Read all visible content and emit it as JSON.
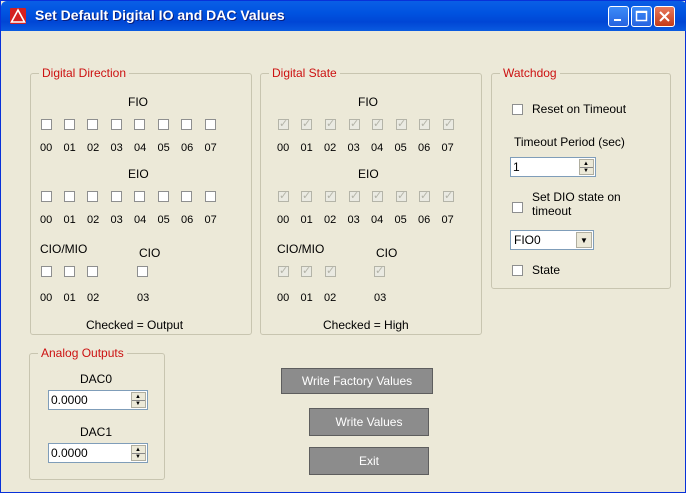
{
  "window": {
    "title": "Set Default Digital IO and DAC Values"
  },
  "digital_direction": {
    "legend": "Digital Direction",
    "fio_label": "FIO",
    "eio_label": "EIO",
    "ciomio_label": "CIO/MIO",
    "cio_label": "CIO",
    "bits8": [
      "00",
      "01",
      "02",
      "03",
      "04",
      "05",
      "06",
      "07"
    ],
    "bits3": [
      "00",
      "01",
      "02"
    ],
    "cio_bit": "03",
    "footer": "Checked = Output"
  },
  "digital_state": {
    "legend": "Digital State",
    "fio_label": "FIO",
    "eio_label": "EIO",
    "ciomio_label": "CIO/MIO",
    "cio_label": "CIO",
    "bits8": [
      "00",
      "01",
      "02",
      "03",
      "04",
      "05",
      "06",
      "07"
    ],
    "bits3": [
      "00",
      "01",
      "02"
    ],
    "cio_bit": "03",
    "footer": "Checked = High"
  },
  "watchdog": {
    "legend": "Watchdog",
    "reset_label": "Reset on Timeout",
    "timeout_label": "Timeout Period (sec)",
    "timeout_value": "1",
    "set_dio_label_1": "Set DIO state on",
    "set_dio_label_2": "timeout",
    "dio_selected": "FIO0",
    "state_label": "State"
  },
  "analog_outputs": {
    "legend": "Analog Outputs",
    "dac0_label": "DAC0",
    "dac0_value": "0.0000",
    "dac1_label": "DAC1",
    "dac1_value": "0.0000"
  },
  "buttons": {
    "write_factory": "Write Factory Values",
    "write_values": "Write Values",
    "exit": "Exit"
  },
  "colors": {
    "titlebar": "#0054E3",
    "legend": "#CC1111",
    "button": "#8C8C8C"
  }
}
